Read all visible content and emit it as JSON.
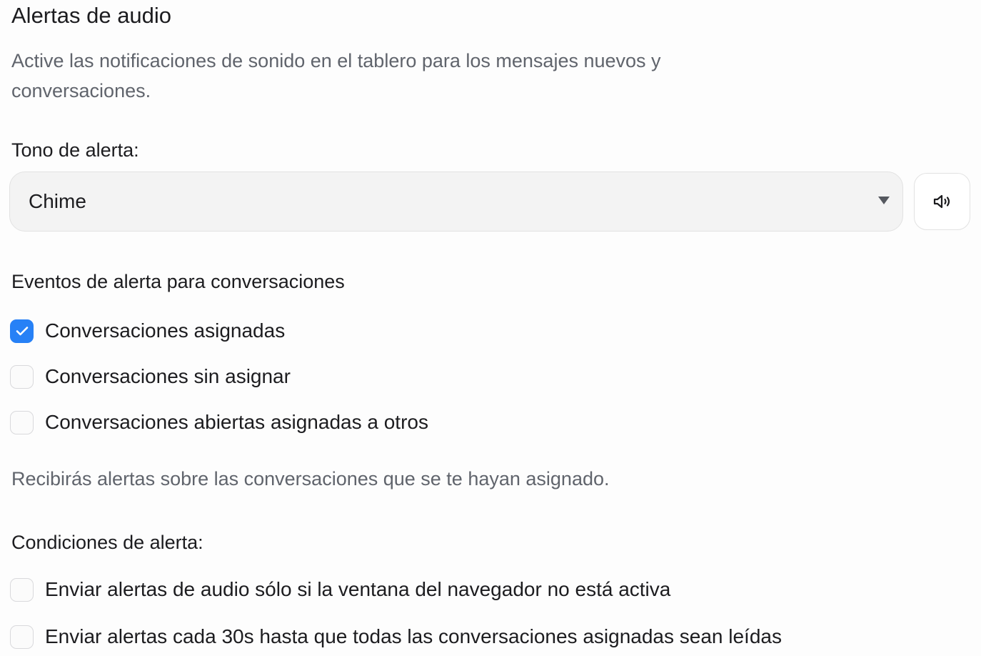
{
  "header": {
    "title": "Alertas de audio",
    "description": "Active las notificaciones de sonido en el tablero para los mensajes nuevos y conversaciones."
  },
  "tone": {
    "label": "Tono de alerta:",
    "selected": "Chime",
    "play_icon": "speaker-icon"
  },
  "events": {
    "label": "Eventos de alerta para conversaciones",
    "options": [
      {
        "label": "Conversaciones asignadas",
        "checked": true
      },
      {
        "label": "Conversaciones sin asignar",
        "checked": false
      },
      {
        "label": "Conversaciones abiertas asignadas a otros",
        "checked": false
      }
    ],
    "hint": "Recibirás alertas sobre las conversaciones que se te hayan asignado."
  },
  "conditions": {
    "label": "Condiciones de alerta:",
    "options": [
      {
        "label": "Enviar alertas de audio sólo si la ventana del navegador no está activa",
        "checked": false
      },
      {
        "label": "Enviar alertas cada 30s hasta que todas las conversaciones asignadas sean leídas",
        "checked": false
      }
    ]
  },
  "colors": {
    "accent": "#2781f6",
    "muted_text": "#60646c",
    "text": "#1c1c1f"
  }
}
